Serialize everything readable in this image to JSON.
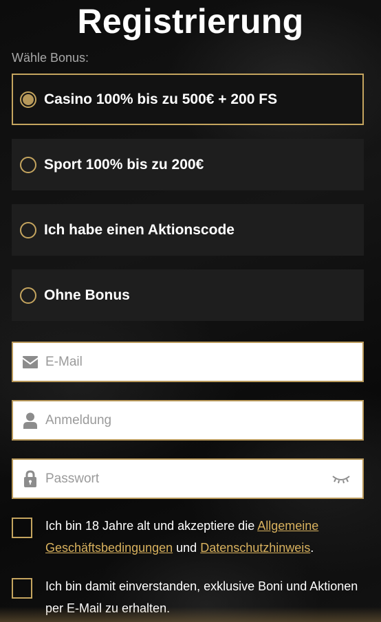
{
  "header": {
    "title": "Registrierung"
  },
  "bonus": {
    "label": "Wähle Bonus:",
    "options": [
      {
        "label": "Casino 100% bis zu 500€ + 200 FS",
        "selected": true
      },
      {
        "label": "Sport 100% bis zu 200€",
        "selected": false
      },
      {
        "label": "Ich habe einen Aktionscode",
        "selected": false
      },
      {
        "label": "Ohne Bonus",
        "selected": false
      }
    ]
  },
  "form": {
    "email": {
      "placeholder": "E-Mail",
      "value": "",
      "icon": "envelope-icon"
    },
    "login": {
      "placeholder": "Anmeldung",
      "value": "",
      "icon": "user-icon"
    },
    "password": {
      "placeholder": "Passwort",
      "value": "",
      "icon": "lock-icon",
      "toggle_icon": "eye-closed-icon"
    }
  },
  "consents": {
    "terms": {
      "checked": false,
      "text_before": "Ich bin 18 Jahre alt und akzeptiere die ",
      "link1": "Allgemeine Geschäftsbedingungen",
      "text_between": " und ",
      "link2": "Datenschutzhinweis",
      "text_after": "."
    },
    "marketing": {
      "checked": false,
      "text": "Ich bin damit einverstanden, exklusive Boni und Aktionen per E-Mail zu erhalten."
    }
  },
  "colors": {
    "accent": "#c5a55f",
    "link": "#d9b25e",
    "option_bg": "#1e1e1e",
    "page_bg": "#111111"
  }
}
